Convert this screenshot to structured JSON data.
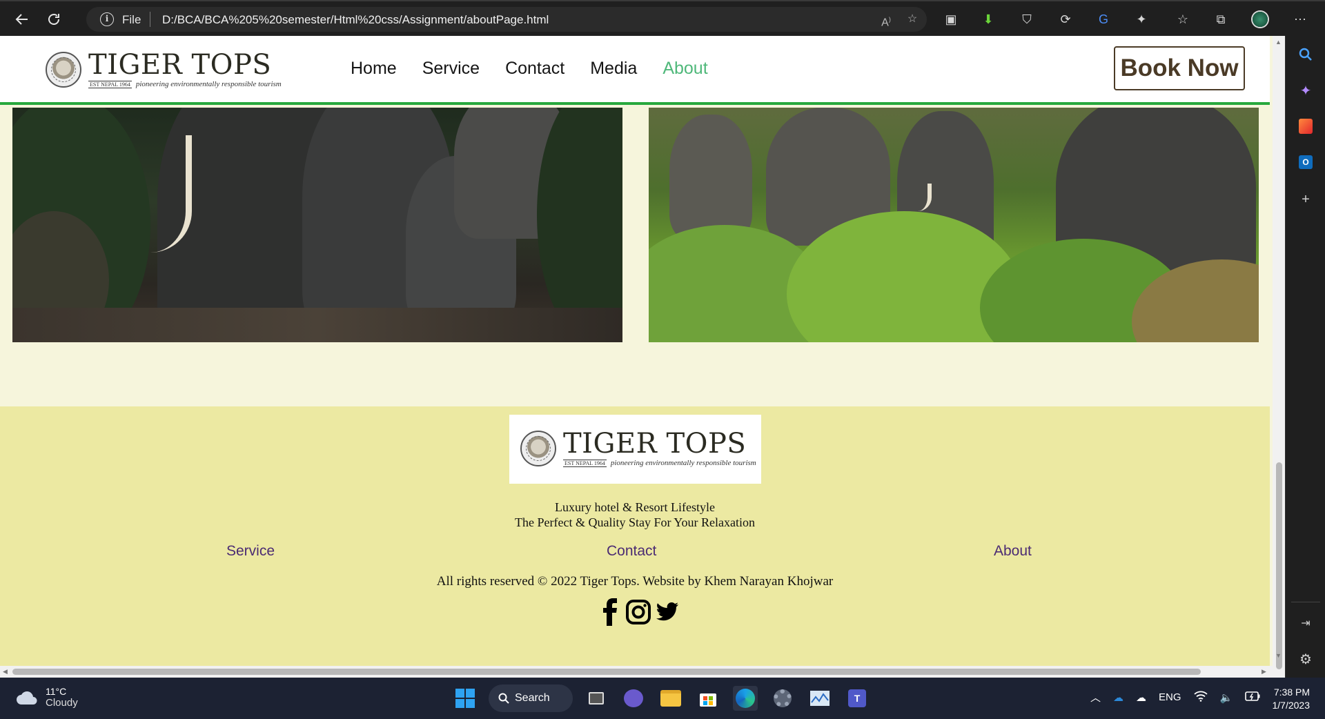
{
  "browser": {
    "scheme_label": "File",
    "url": "D:/BCA/BCA%205%20semester/Html%20css/Assignment/aboutPage.html"
  },
  "site": {
    "logo": {
      "name": "TIGER TOPS",
      "est": "EST NEPAL 1964",
      "tagline": "pioneering environmentally responsible tourism"
    },
    "nav": [
      "Home",
      "Service",
      "Contact",
      "Media",
      "About"
    ],
    "active_nav": "About",
    "book_now": "Book Now"
  },
  "footer": {
    "line1": "Luxury hotel & Resort Lifestyle",
    "line2": "The Perfect & Quality Stay For Your Relaxation",
    "links": [
      "Service",
      "Contact",
      "About"
    ],
    "copyright": "All rights reserved © 2022 Tiger Tops. Website by Khem Narayan Khojwar",
    "socials": [
      "facebook-icon",
      "instagram-icon",
      "twitter-icon"
    ]
  },
  "taskbar": {
    "weather_temp": "11°C",
    "weather_desc": "Cloudy",
    "search_label": "Search",
    "language": "ENG",
    "time": "7:38 PM",
    "date": "1/7/2023"
  },
  "colors": {
    "accent_green": "#27a83d",
    "active_nav": "#4fb87a",
    "footer_bg": "#ece9a2",
    "footer_link": "#4b2b73",
    "page_bg": "#f6f5dc"
  }
}
